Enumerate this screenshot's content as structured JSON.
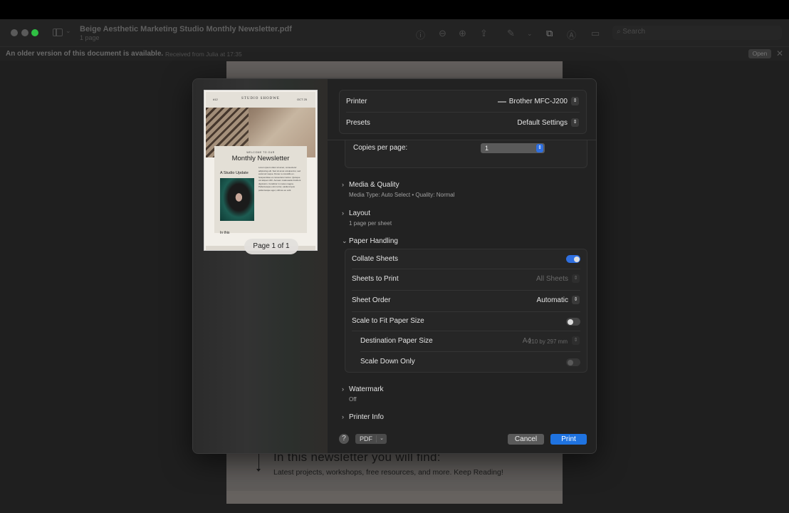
{
  "window": {
    "title": "Beige Aesthetic Marketing Studio Monthly Newsletter.pdf",
    "subtitle": "1 page",
    "search_placeholder": "Search",
    "toolbar_icons": [
      "info-icon",
      "zoom-out-icon",
      "zoom-in-icon",
      "share-icon",
      "markup-pencil-icon",
      "chevron-down-icon",
      "rotate-icon",
      "highlight-icon",
      "sign-icon"
    ]
  },
  "infobar": {
    "message": "An older version of this document is available.",
    "detail": "Received from Julia at 17:35",
    "open_label": "Open",
    "close_glyph": "✕"
  },
  "background_page": {
    "heading": "In this newsletter you will find:",
    "body": "Latest projects, workshops, free resources, and more. Keep Reading!"
  },
  "preview": {
    "issue": "#12",
    "brand": "STUDIO SHODWE",
    "date": "OCT 25",
    "welcome": "WELCOME TO OUR",
    "title": "Monthly Newsletter",
    "section": "A Studio Update",
    "lorem": "Lorem ipsum dolor sit amet, consectetur adipiscing elit. Sed sit amet volutpat dui, sed euismod neque. Donec a convallis ex. Suspendisse et consectetur lectus. Quisque vel aliquet nibh. Aenean malesuada tincidunt dignissim. Curabitur in metus magna. Pellentesque enim tortor, eleifend quis pellentesque eget, ultrices eu velit.",
    "bottom": "In this",
    "page_indicator": "Page 1 of 1"
  },
  "print": {
    "printer_label": "Printer",
    "printer_value": "Brother MFC-J200",
    "presets_label": "Presets",
    "presets_value": "Default Settings",
    "copies_per_page_label": "Copies per page:",
    "copies_per_page_value": "1",
    "sections": [
      {
        "label": "Media & Quality",
        "summary": "Media Type: Auto Select • Quality: Normal",
        "expanded": false
      },
      {
        "label": "Layout",
        "summary": "1 page per sheet",
        "expanded": false
      },
      {
        "label": "Paper Handling",
        "expanded": true
      },
      {
        "label": "Watermark",
        "summary": "Off",
        "expanded": false
      },
      {
        "label": "Printer Info",
        "expanded": false
      }
    ],
    "paper_handling": {
      "collate_label": "Collate Sheets",
      "collate_on": true,
      "sheets_to_print_label": "Sheets to Print",
      "sheets_to_print_value": "All Sheets",
      "sheet_order_label": "Sheet Order",
      "sheet_order_value": "Automatic",
      "scale_fit_label": "Scale to Fit Paper Size",
      "scale_fit_on": false,
      "dest_size_label": "Destination Paper Size",
      "dest_size_value": "A4",
      "dest_size_detail": "210 by 297 mm",
      "scale_down_label": "Scale Down Only",
      "scale_down_on": false
    },
    "help_label": "?",
    "pdf_label": "PDF",
    "cancel_label": "Cancel",
    "print_label": "Print"
  },
  "colors": {
    "accent": "#1f73e0",
    "traffic_green": "#2fbf43"
  }
}
